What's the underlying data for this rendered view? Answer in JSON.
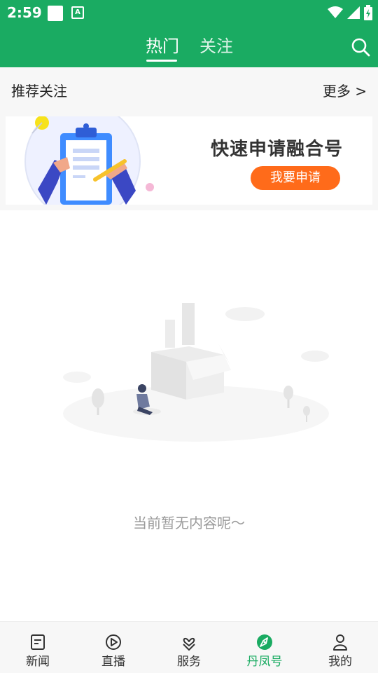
{
  "status_bar": {
    "time": "2:59",
    "a_icon_text": "A"
  },
  "header": {
    "tabs": [
      {
        "label": "热门",
        "active": true
      },
      {
        "label": "关注",
        "active": false
      }
    ],
    "accent_color": "#1aab62"
  },
  "recommend": {
    "title": "推荐关注",
    "more_label": "更多 >"
  },
  "banner": {
    "title": "快速申请融合号",
    "button_label": "我要申请",
    "button_color": "#ff6b1a"
  },
  "empty_state": {
    "message": "当前暂无内容呢～"
  },
  "bottom_nav": {
    "items": [
      {
        "label": "新闻",
        "icon": "news-icon",
        "active": false
      },
      {
        "label": "直播",
        "icon": "live-play-icon",
        "active": false
      },
      {
        "label": "服务",
        "icon": "service-icon",
        "active": false
      },
      {
        "label": "丹凤号",
        "icon": "compass-icon",
        "active": true
      },
      {
        "label": "我的",
        "icon": "profile-icon",
        "active": false
      }
    ]
  }
}
